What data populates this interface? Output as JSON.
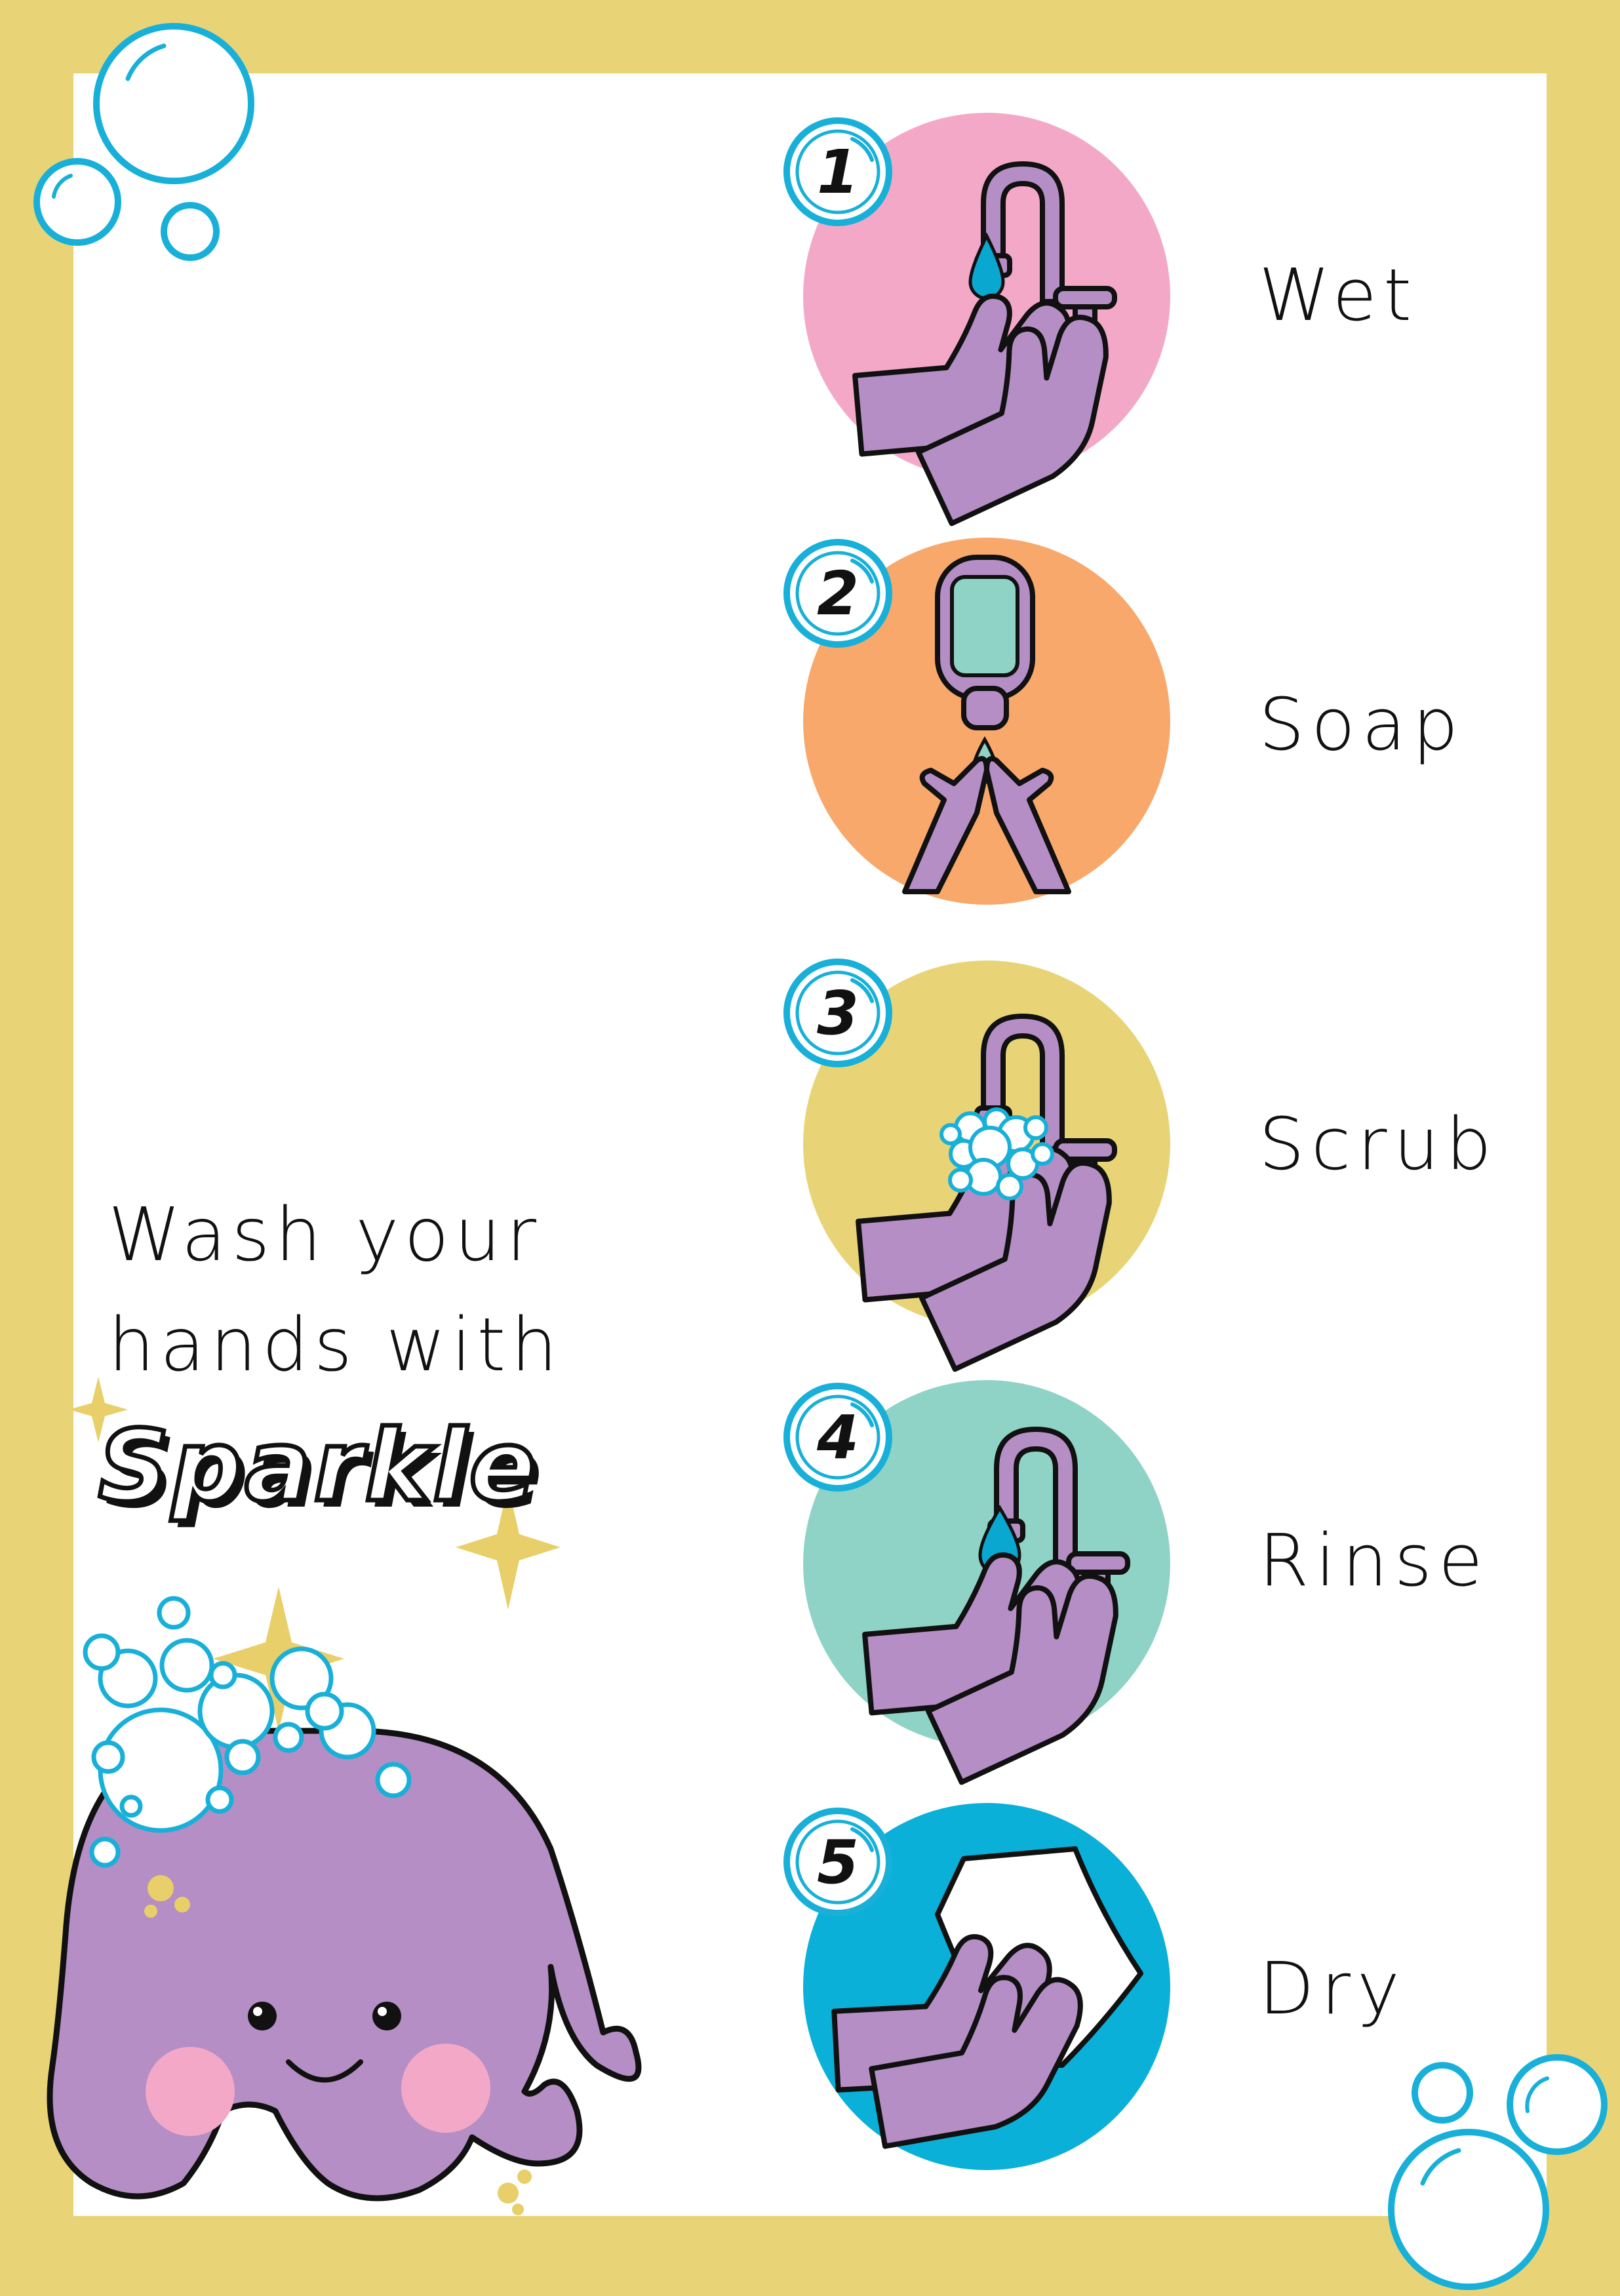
{
  "headline": {
    "line1": "Wash your",
    "line2": "hands with"
  },
  "brand_name": "Sparkle",
  "steps": [
    {
      "number": "1",
      "label": "Wet",
      "color": "#F4A8C8",
      "icon": "faucet-wet-hands-icon"
    },
    {
      "number": "2",
      "label": "Soap",
      "color": "#F8A86A",
      "icon": "soap-dispenser-icon"
    },
    {
      "number": "3",
      "label": "Scrub",
      "color": "#E8D476",
      "icon": "scrub-bubbles-hands-icon"
    },
    {
      "number": "4",
      "label": "Rinse",
      "color": "#8FD3C6",
      "icon": "faucet-rinse-hands-icon"
    },
    {
      "number": "5",
      "label": "Dry",
      "color": "#0AB0D8",
      "icon": "towel-dry-hands-icon"
    }
  ],
  "colors": {
    "frame": "#E8D476",
    "hand": "#B48EC4",
    "mascot": "#B48EC4",
    "bubble": "#18B0D8",
    "sparkle": "#E8CF6A"
  }
}
